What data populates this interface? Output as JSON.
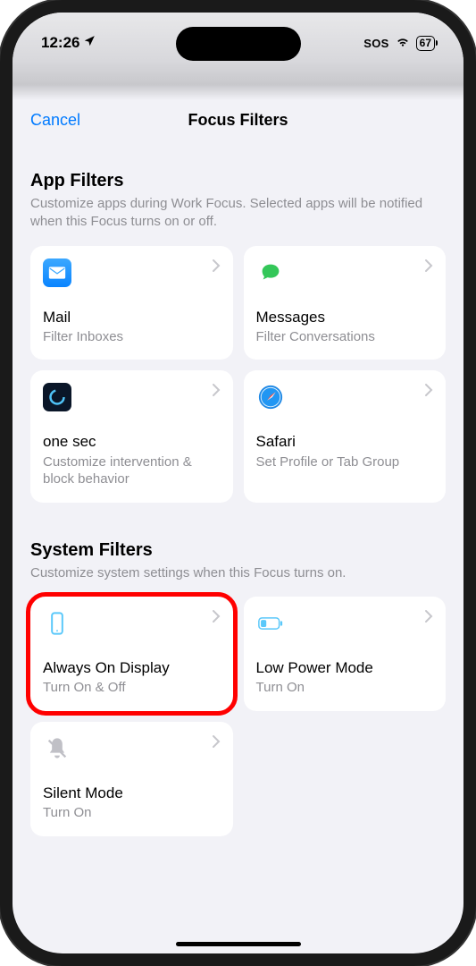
{
  "statusBar": {
    "time": "12:26",
    "sos": "SOS",
    "battery": "67"
  },
  "nav": {
    "cancel": "Cancel",
    "title": "Focus Filters"
  },
  "appFilters": {
    "title": "App Filters",
    "desc": "Customize apps during Work Focus. Selected apps will be notified when this Focus turns on or off.",
    "items": [
      {
        "name": "Mail",
        "sub": "Filter Inboxes"
      },
      {
        "name": "Messages",
        "sub": "Filter Conversations"
      },
      {
        "name": "one sec",
        "sub": "Customize intervention & block behavior"
      },
      {
        "name": "Safari",
        "sub": "Set Profile or Tab Group"
      }
    ]
  },
  "systemFilters": {
    "title": "System Filters",
    "desc": "Customize system settings when this Focus turns on.",
    "items": [
      {
        "name": "Always On Display",
        "sub": "Turn On & Off"
      },
      {
        "name": "Low Power Mode",
        "sub": "Turn On"
      },
      {
        "name": "Silent Mode",
        "sub": "Turn On"
      }
    ]
  }
}
